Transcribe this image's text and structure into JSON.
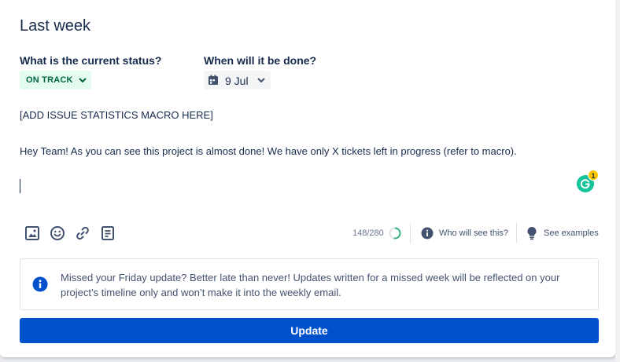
{
  "section": {
    "title": "Last week"
  },
  "status": {
    "label": "What is the current status?",
    "value": "ON TRACK",
    "color": "#006644"
  },
  "due": {
    "label": "When will it be done?",
    "value": "9 Jul"
  },
  "editor": {
    "macro_placeholder": "[ADD ISSUE STATISTICS MACRO HERE]",
    "body": "Hey Team!  As you can see this project is almost done!  We have only X tickets left in progress (refer to macro).",
    "grammarly_count": "1"
  },
  "toolbar": {
    "icons": [
      "image-icon",
      "emoji-icon",
      "link-icon",
      "document-icon"
    ],
    "char_count": "148/280",
    "char_progress": 0.53,
    "who_will_see": "Who will see this?",
    "see_examples": "See examples"
  },
  "notice": {
    "text": "Missed your Friday update? Better late than never! Updates written for a missed week will be reflected on your project’s timeline only and won’t make it into the weekly email."
  },
  "actions": {
    "update_label": "Update",
    "accent": "#0052cc"
  }
}
